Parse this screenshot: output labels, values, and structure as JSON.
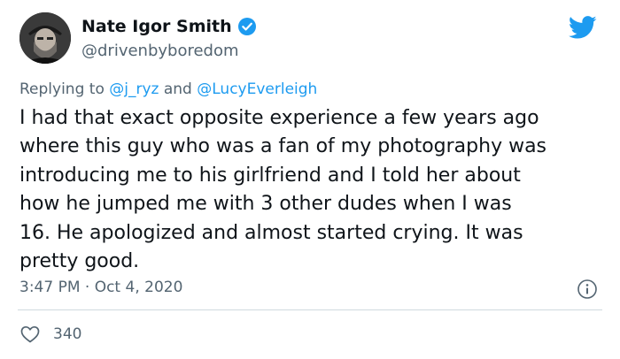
{
  "author": {
    "display_name": "Nate Igor Smith",
    "handle": "@drivenbyboredom"
  },
  "reply": {
    "prefix": "Replying to ",
    "mention_1": "@j_ryz",
    "conjunction": " and ",
    "mention_2": "@LucyEverleigh"
  },
  "tweet": {
    "text": "I had that exact opposite experience a few years ago\nwhere this guy who was a fan of my photography was\nintroducing me to his girlfriend and I told her about\nhow he jumped me with 3 other dudes when I was\n16. He apologized and almost started crying. It was\npretty good.",
    "timestamp": "3:47 PM · Oct 4, 2020"
  },
  "engagement": {
    "likes": "340"
  },
  "icons": {
    "verified": "verified-badge-icon",
    "brand": "twitter-bird-icon",
    "info": "info-icon",
    "like": "heart-icon"
  },
  "colors": {
    "brand_blue": "#1d9bf0",
    "text_primary": "#0f1419",
    "text_secondary": "#536471",
    "divider": "#cfd9de"
  }
}
